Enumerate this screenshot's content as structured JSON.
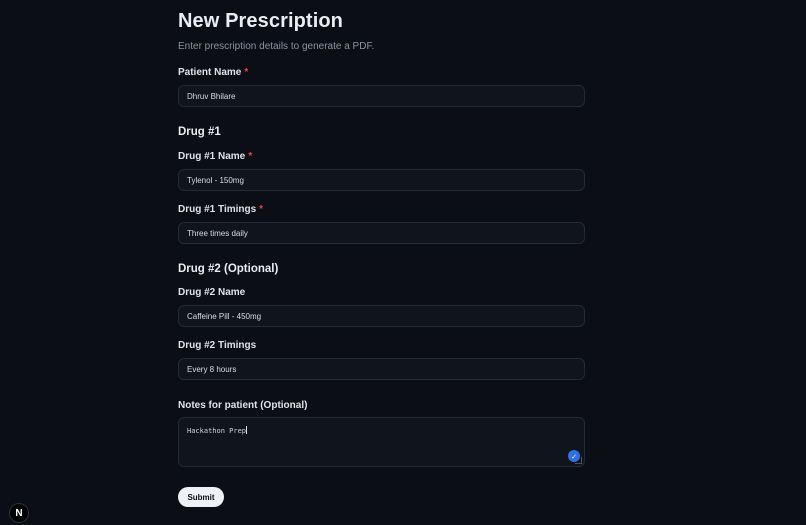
{
  "header": {
    "title": "New Prescription",
    "subtitle": "Enter prescription details to generate a PDF."
  },
  "patient": {
    "label": "Patient Name",
    "required_mark": "*",
    "value": "Dhruv Bhilare"
  },
  "drug1": {
    "section_title": "Drug #1",
    "name_label": "Drug #1 Name",
    "name_required_mark": "*",
    "name_value": "Tylenol - 150mg",
    "timings_label": "Drug #1 Timings",
    "timings_required_mark": "*",
    "timings_value": "Three times daily"
  },
  "drug2": {
    "section_title": "Drug #2 (Optional)",
    "name_label": "Drug #2 Name",
    "name_value": "Caffeine Pill - 450mg",
    "timings_label": "Drug #2 Timings",
    "timings_value": "Every 8 hours"
  },
  "notes": {
    "label": "Notes for patient (Optional)",
    "value": "Hackathon Prep"
  },
  "actions": {
    "submit_label": "Submit"
  },
  "devtools": {
    "badge_label": "N"
  },
  "icons": {
    "grammar": "check-circle-icon"
  },
  "colors": {
    "background": "#0b0e14",
    "required": "#ef4444",
    "button_bg": "#eef1f5",
    "badge_blue": "#2f6fe4"
  }
}
